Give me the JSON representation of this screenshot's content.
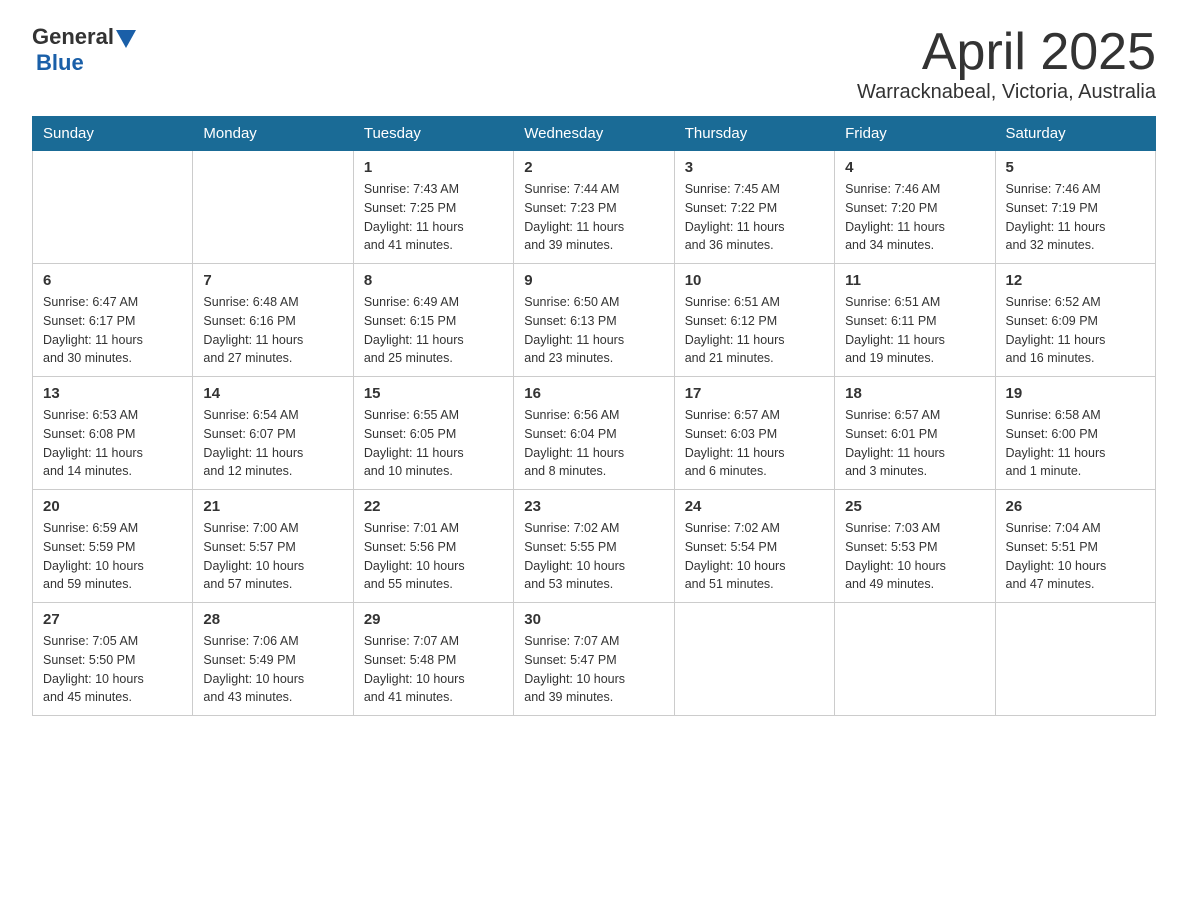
{
  "header": {
    "logo_general": "General",
    "logo_blue": "Blue",
    "title": "April 2025",
    "location": "Warracknabeal, Victoria, Australia"
  },
  "days_of_week": [
    "Sunday",
    "Monday",
    "Tuesday",
    "Wednesday",
    "Thursday",
    "Friday",
    "Saturday"
  ],
  "weeks": [
    [
      {
        "day": "",
        "info": ""
      },
      {
        "day": "",
        "info": ""
      },
      {
        "day": "1",
        "info": "Sunrise: 7:43 AM\nSunset: 7:25 PM\nDaylight: 11 hours\nand 41 minutes."
      },
      {
        "day": "2",
        "info": "Sunrise: 7:44 AM\nSunset: 7:23 PM\nDaylight: 11 hours\nand 39 minutes."
      },
      {
        "day": "3",
        "info": "Sunrise: 7:45 AM\nSunset: 7:22 PM\nDaylight: 11 hours\nand 36 minutes."
      },
      {
        "day": "4",
        "info": "Sunrise: 7:46 AM\nSunset: 7:20 PM\nDaylight: 11 hours\nand 34 minutes."
      },
      {
        "day": "5",
        "info": "Sunrise: 7:46 AM\nSunset: 7:19 PM\nDaylight: 11 hours\nand 32 minutes."
      }
    ],
    [
      {
        "day": "6",
        "info": "Sunrise: 6:47 AM\nSunset: 6:17 PM\nDaylight: 11 hours\nand 30 minutes."
      },
      {
        "day": "7",
        "info": "Sunrise: 6:48 AM\nSunset: 6:16 PM\nDaylight: 11 hours\nand 27 minutes."
      },
      {
        "day": "8",
        "info": "Sunrise: 6:49 AM\nSunset: 6:15 PM\nDaylight: 11 hours\nand 25 minutes."
      },
      {
        "day": "9",
        "info": "Sunrise: 6:50 AM\nSunset: 6:13 PM\nDaylight: 11 hours\nand 23 minutes."
      },
      {
        "day": "10",
        "info": "Sunrise: 6:51 AM\nSunset: 6:12 PM\nDaylight: 11 hours\nand 21 minutes."
      },
      {
        "day": "11",
        "info": "Sunrise: 6:51 AM\nSunset: 6:11 PM\nDaylight: 11 hours\nand 19 minutes."
      },
      {
        "day": "12",
        "info": "Sunrise: 6:52 AM\nSunset: 6:09 PM\nDaylight: 11 hours\nand 16 minutes."
      }
    ],
    [
      {
        "day": "13",
        "info": "Sunrise: 6:53 AM\nSunset: 6:08 PM\nDaylight: 11 hours\nand 14 minutes."
      },
      {
        "day": "14",
        "info": "Sunrise: 6:54 AM\nSunset: 6:07 PM\nDaylight: 11 hours\nand 12 minutes."
      },
      {
        "day": "15",
        "info": "Sunrise: 6:55 AM\nSunset: 6:05 PM\nDaylight: 11 hours\nand 10 minutes."
      },
      {
        "day": "16",
        "info": "Sunrise: 6:56 AM\nSunset: 6:04 PM\nDaylight: 11 hours\nand 8 minutes."
      },
      {
        "day": "17",
        "info": "Sunrise: 6:57 AM\nSunset: 6:03 PM\nDaylight: 11 hours\nand 6 minutes."
      },
      {
        "day": "18",
        "info": "Sunrise: 6:57 AM\nSunset: 6:01 PM\nDaylight: 11 hours\nand 3 minutes."
      },
      {
        "day": "19",
        "info": "Sunrise: 6:58 AM\nSunset: 6:00 PM\nDaylight: 11 hours\nand 1 minute."
      }
    ],
    [
      {
        "day": "20",
        "info": "Sunrise: 6:59 AM\nSunset: 5:59 PM\nDaylight: 10 hours\nand 59 minutes."
      },
      {
        "day": "21",
        "info": "Sunrise: 7:00 AM\nSunset: 5:57 PM\nDaylight: 10 hours\nand 57 minutes."
      },
      {
        "day": "22",
        "info": "Sunrise: 7:01 AM\nSunset: 5:56 PM\nDaylight: 10 hours\nand 55 minutes."
      },
      {
        "day": "23",
        "info": "Sunrise: 7:02 AM\nSunset: 5:55 PM\nDaylight: 10 hours\nand 53 minutes."
      },
      {
        "day": "24",
        "info": "Sunrise: 7:02 AM\nSunset: 5:54 PM\nDaylight: 10 hours\nand 51 minutes."
      },
      {
        "day": "25",
        "info": "Sunrise: 7:03 AM\nSunset: 5:53 PM\nDaylight: 10 hours\nand 49 minutes."
      },
      {
        "day": "26",
        "info": "Sunrise: 7:04 AM\nSunset: 5:51 PM\nDaylight: 10 hours\nand 47 minutes."
      }
    ],
    [
      {
        "day": "27",
        "info": "Sunrise: 7:05 AM\nSunset: 5:50 PM\nDaylight: 10 hours\nand 45 minutes."
      },
      {
        "day": "28",
        "info": "Sunrise: 7:06 AM\nSunset: 5:49 PM\nDaylight: 10 hours\nand 43 minutes."
      },
      {
        "day": "29",
        "info": "Sunrise: 7:07 AM\nSunset: 5:48 PM\nDaylight: 10 hours\nand 41 minutes."
      },
      {
        "day": "30",
        "info": "Sunrise: 7:07 AM\nSunset: 5:47 PM\nDaylight: 10 hours\nand 39 minutes."
      },
      {
        "day": "",
        "info": ""
      },
      {
        "day": "",
        "info": ""
      },
      {
        "day": "",
        "info": ""
      }
    ]
  ]
}
